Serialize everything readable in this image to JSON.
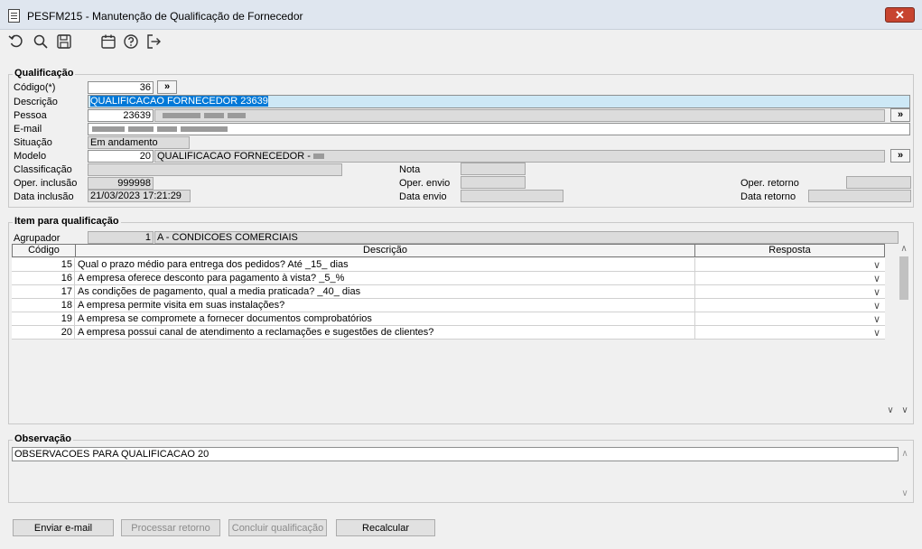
{
  "window": {
    "title": "PESFM215 - Manutenção de Qualificação de Fornecedor",
    "close_label": "✕"
  },
  "toolbar": {
    "icons": [
      "undo-icon",
      "search-icon",
      "save-icon",
      "calendar-icon",
      "help-icon",
      "exit-icon"
    ]
  },
  "qualificacao": {
    "section_title": "Qualificação",
    "codigo_label": "Código(*)",
    "codigo_value": "36",
    "descricao_label": "Descrição",
    "descricao_value": "QUALIFICACAO FORNECEDOR 23639",
    "pessoa_label": "Pessoa",
    "pessoa_value": "23639",
    "email_label": "E-mail",
    "situacao_label": "Situação",
    "situacao_value": "Em andamento",
    "modelo_label": "Modelo",
    "modelo_value": "20",
    "modelo_desc": "QUALIFICACAO FORNECEDOR -",
    "classificacao_label": "Classificação",
    "nota_label": "Nota",
    "oper_inclusao_label": "Oper. inclusão",
    "oper_inclusao_value": "999998",
    "oper_envio_label": "Oper. envio",
    "oper_retorno_label": "Oper. retorno",
    "data_inclusao_label": "Data inclusão",
    "data_inclusao_value": "21/03/2023 17:21:29",
    "data_envio_label": "Data envio",
    "data_retorno_label": "Data retorno",
    "lookup_label": "»"
  },
  "item": {
    "section_title": "Item para qualificação",
    "agrupador_label": "Agrupador",
    "agrupador_value": "1",
    "agrupador_desc": "A - CONDICOES COMERCIAIS",
    "columns": [
      "Código",
      "Descrição",
      "Resposta"
    ],
    "rows": [
      {
        "codigo": "15",
        "descricao": "Qual o prazo médio para entrega dos pedidos? Até _15_ dias"
      },
      {
        "codigo": "16",
        "descricao": "A empresa oferece desconto para pagamento à vista? _5_%"
      },
      {
        "codigo": "17",
        "descricao": "As condições de pagamento, qual a media praticada? _40_ dias"
      },
      {
        "codigo": "18",
        "descricao": "A empresa permite visita em suas instalações?"
      },
      {
        "codigo": "19",
        "descricao": "A empresa se compromete a fornecer documentos comprobatórios"
      },
      {
        "codigo": "20",
        "descricao": "A empresa possui canal de atendimento a reclamações e sugestões de clientes?"
      }
    ]
  },
  "observacao": {
    "section_title": "Observação",
    "value": "OBSERVACOES PARA QUALIFICACAO 20"
  },
  "buttons": {
    "enviar_email": "Enviar e-mail",
    "processar_retorno": "Processar retorno",
    "concluir": "Concluir qualificação",
    "recalcular": "Recalcular"
  }
}
